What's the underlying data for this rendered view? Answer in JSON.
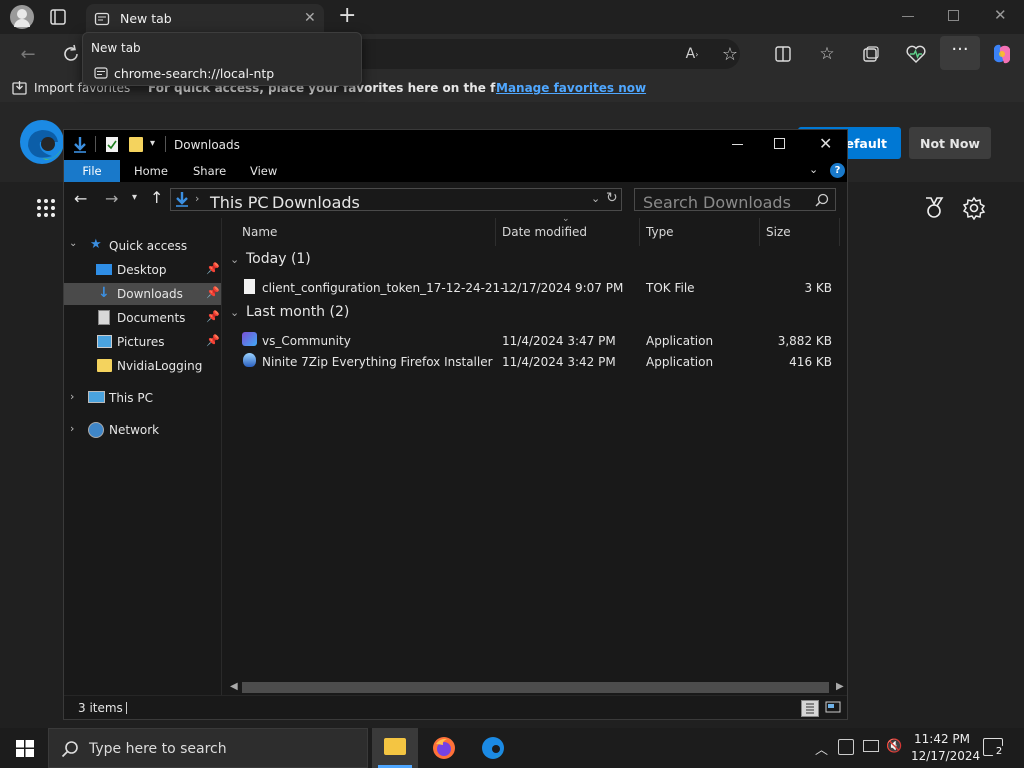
{
  "browser": {
    "tab_title": "New tab",
    "popup": {
      "title": "New tab",
      "url": "chrome-search://local-ntp"
    },
    "favbar": {
      "import_label": "Import favorites",
      "tip_text": "For quick access, place your favorites here on the favorites bar.",
      "manage_link": "Manage favorites now"
    },
    "banner": {
      "default_button": "default",
      "not_now_button": "Not Now"
    }
  },
  "explorer": {
    "title": "Downloads",
    "ribbon": {
      "file": "File",
      "home": "Home",
      "share": "Share",
      "view": "View"
    },
    "address": {
      "crumb1": "This PC",
      "crumb2": "Downloads",
      "search_placeholder": "Search Downloads"
    },
    "nav": {
      "quick_access": "Quick access",
      "desktop": "Desktop",
      "downloads": "Downloads",
      "documents": "Documents",
      "pictures": "Pictures",
      "nvidia": "NvidiaLogging",
      "this_pc": "This PC",
      "network": "Network"
    },
    "columns": {
      "name": "Name",
      "date": "Date modified",
      "type": "Type",
      "size": "Size"
    },
    "groups": {
      "today": "Today (1)",
      "last_month": "Last month (2)"
    },
    "files": [
      {
        "name": "client_configuration_token_17-12-24-21-...",
        "date": "12/17/2024 9:07 PM",
        "type": "TOK File",
        "size": "3 KB"
      },
      {
        "name": "vs_Community",
        "date": "11/4/2024 3:47 PM",
        "type": "Application",
        "size": "3,882 KB"
      },
      {
        "name": "Ninite 7Zip Everything Firefox Installer",
        "date": "11/4/2024 3:42 PM",
        "type": "Application",
        "size": "416 KB"
      }
    ],
    "status_items": "3 items"
  },
  "taskbar": {
    "search_placeholder": "Type here to search",
    "time": "11:42 PM",
    "date": "12/17/2024",
    "notification_count": "2"
  },
  "colors": {
    "accent": "#0078d4",
    "link": "#4fa7ff",
    "edge_blue": "#1b8ae4"
  }
}
